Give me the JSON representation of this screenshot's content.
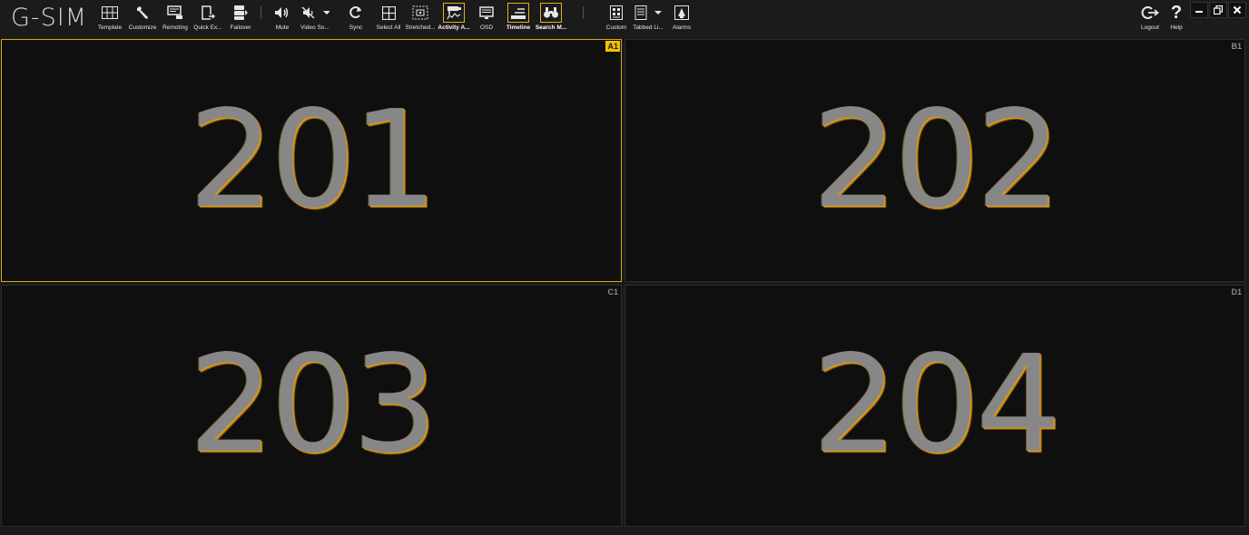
{
  "app": {
    "title": "G-SIM"
  },
  "toolbar": {
    "template": "Template",
    "customize": "Customize",
    "remoting": "Remoting",
    "quick_export": "Quick Ex...",
    "failover": "Failover",
    "mute": "Mute",
    "video_source": "Video So...",
    "sync": "Sync",
    "select_all": "Select All",
    "stretched": "Stretched...",
    "activity": "Activity A...",
    "osd": "OSD",
    "timeline": "Timeline",
    "search": "Search M...",
    "custom": "Custom",
    "tabbed": "Tabbed Li...",
    "alarms": "Alarms",
    "logout": "Logout",
    "help": "Help"
  },
  "tiles": [
    {
      "number": "201",
      "tag": "A1",
      "selected": true
    },
    {
      "number": "202",
      "tag": "B1",
      "selected": false
    },
    {
      "number": "203",
      "tag": "C1",
      "selected": false
    },
    {
      "number": "204",
      "tag": "D1",
      "selected": false
    }
  ],
  "colors": {
    "accent": "#e2b21a",
    "tile_bg": "#0f0f0f",
    "toolbar_bg": "#1b1b1b"
  }
}
